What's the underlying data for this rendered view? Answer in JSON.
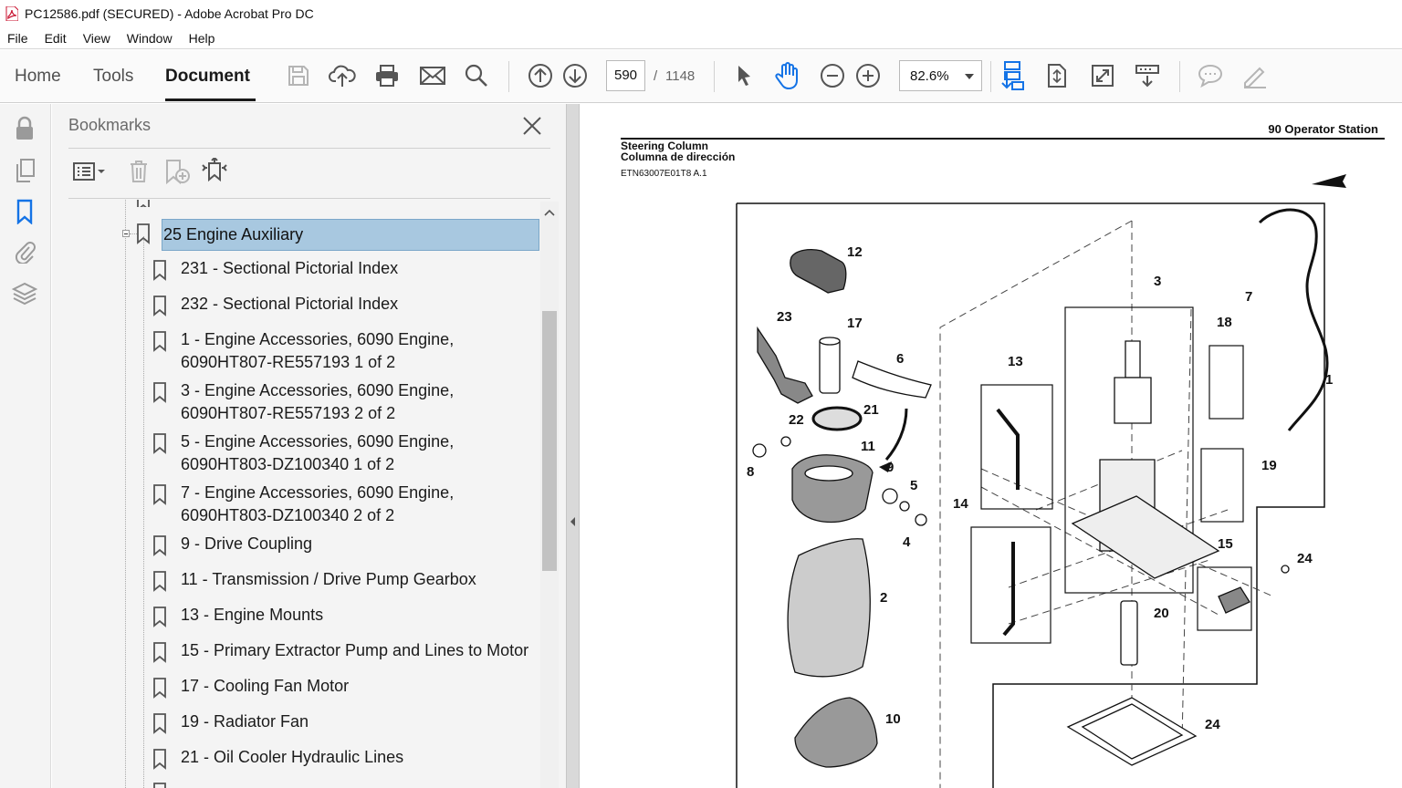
{
  "window": {
    "title": "PC12586.pdf (SECURED) - Adobe Acrobat Pro DC"
  },
  "menu": {
    "items": [
      "File",
      "Edit",
      "View",
      "Window",
      "Help"
    ]
  },
  "toolbar": {
    "tabs": {
      "home": "Home",
      "tools": "Tools",
      "document": "Document"
    },
    "page_current": "590",
    "page_separator": "/",
    "page_total": "1148",
    "zoom": "82.6%"
  },
  "bookmarks_panel": {
    "title": "Bookmarks",
    "selected": "25 Engine Auxiliary",
    "items": [
      "231 - Sectional Pictorial Index",
      "232 - Sectional Pictorial Index",
      "1 - Engine Accessories, 6090 Engine, 6090HT807-RE557193 1 of 2",
      "3 - Engine Accessories, 6090 Engine, 6090HT807-RE557193 2 of 2",
      "5 - Engine Accessories, 6090 Engine, 6090HT803-DZ100340 1 of 2",
      "7 - Engine Accessories, 6090 Engine, 6090HT803-DZ100340 2 of 2",
      "9 - Drive Coupling",
      "11 - Transmission / Drive Pump Gearbox",
      "13 - Engine Mounts",
      "15 - Primary Extractor Pump and Lines to Motor",
      "17 - Cooling Fan Motor",
      "19 - Radiator Fan",
      "21 - Oil Cooler Hydraulic Lines"
    ]
  },
  "document": {
    "section_header": "90 Operator Station",
    "title_en": "Steering Column",
    "title_es": "Columna de dirección",
    "reference": "ETN63007E01T8 A.1",
    "callouts": [
      "1",
      "2",
      "3",
      "4",
      "5",
      "6",
      "7",
      "8",
      "9",
      "10",
      "11",
      "12",
      "13",
      "14",
      "15",
      "17",
      "18",
      "19",
      "20",
      "21",
      "22",
      "23",
      "24"
    ]
  },
  "icons": {
    "toolbar": [
      "save-icon",
      "upload-cloud-icon",
      "print-icon",
      "email-icon",
      "search-icon",
      "page-up-icon",
      "page-down-icon",
      "select-cursor-icon",
      "hand-icon",
      "zoom-out-icon",
      "zoom-in-icon",
      "scroll-mode-icon",
      "fit-page-icon",
      "full-screen-icon",
      "read-mode-icon",
      "comment-icon",
      "sign-icon"
    ],
    "rail": [
      "lock-icon",
      "pages-icon",
      "bookmark-icon",
      "attachment-icon",
      "layers-icon"
    ]
  },
  "colors": {
    "selection": "#a8c8e0",
    "accent_blue": "#1473e6"
  }
}
